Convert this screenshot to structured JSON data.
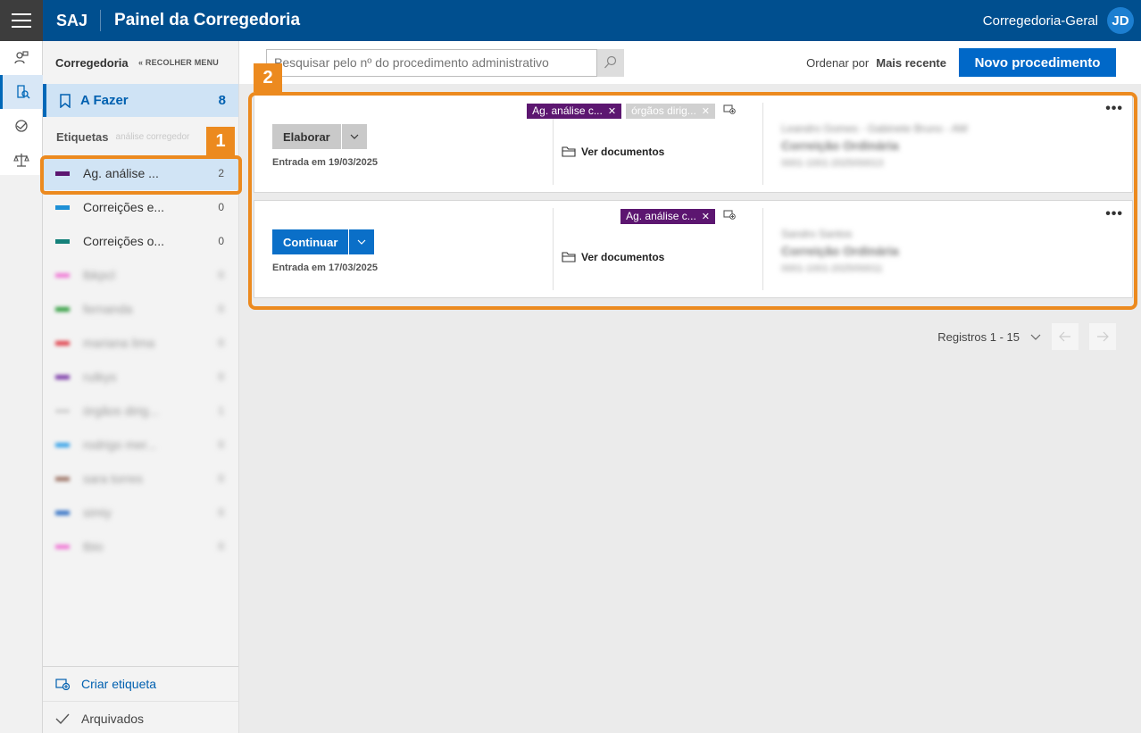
{
  "header": {
    "brand": "SAJ",
    "title": "Painel da Corregedoria",
    "user_name": "Corregedoria-Geral",
    "avatar_initials": "JD",
    "color": "#004f8f"
  },
  "rail": {
    "icons": [
      "user-task-icon",
      "document-search-icon",
      "handshake-icon",
      "scales-icon"
    ],
    "active_index": 1
  },
  "sidebar": {
    "title": "Corregedoria",
    "collapse_label": "RECOLHER MENU",
    "todo_label": "A Fazer",
    "todo_count": "8",
    "tags_title": "Etiquetas",
    "tags_hint": "análise corregedor",
    "tags": [
      {
        "label": "Ag. análise ...",
        "count": "2",
        "color": "#5c1670",
        "selected": true,
        "blurred": false
      },
      {
        "label": "Correições e...",
        "count": "0",
        "color": "#1e90d6",
        "selected": false,
        "blurred": false
      },
      {
        "label": "Correições o...",
        "count": "0",
        "color": "#14817a",
        "selected": false,
        "blurred": false
      },
      {
        "label": "lbkpcl",
        "count": "0",
        "color": "#f07ad6",
        "selected": false,
        "blurred": true
      },
      {
        "label": "fernanda",
        "count": "0",
        "color": "#2e9c3c",
        "selected": false,
        "blurred": true
      },
      {
        "label": "mariana lima",
        "count": "0",
        "color": "#e0404a",
        "selected": false,
        "blurred": true
      },
      {
        "label": "rutkys",
        "count": "0",
        "color": "#7b3aa8",
        "selected": false,
        "blurred": true
      },
      {
        "label": "órgãos dirig...",
        "count": "1",
        "color": "#d6d6d6",
        "selected": false,
        "blurred": true
      },
      {
        "label": "rodrigo mer...",
        "count": "0",
        "color": "#35a2e8",
        "selected": false,
        "blurred": true
      },
      {
        "label": "sara torres",
        "count": "0",
        "color": "#a0786a",
        "selected": false,
        "blurred": true
      },
      {
        "label": "simiy",
        "count": "0",
        "color": "#2f6fc4",
        "selected": false,
        "blurred": true
      },
      {
        "label": "tbio",
        "count": "0",
        "color": "#f07ad6",
        "selected": false,
        "blurred": true
      }
    ],
    "create_label": "Criar etiqueta",
    "archived_label": "Arquivados"
  },
  "toolbar": {
    "search_placeholder": "Pesquisar pelo nº do procedimento administrativo",
    "order_label": "Ordenar por",
    "order_value": "Mais recente",
    "new_button": "Novo procedimento"
  },
  "cards": [
    {
      "action": "Elaborar",
      "action_style": "grey",
      "entry": "Entrada em 19/03/2025",
      "chips": [
        {
          "label": "Ag. análise c...",
          "style": "purple"
        },
        {
          "label": "órgãos dirig...",
          "style": "grey"
        }
      ],
      "docs_label": "Ver documentos",
      "info_line1": "Leandro Gomes - Gabinete Bruno - AM",
      "info_line2": "Correição Ordinária",
      "info_line3": "0001-1001-2025/00013"
    },
    {
      "action": "Continuar",
      "action_style": "blue",
      "entry": "Entrada em 17/03/2025",
      "chips": [
        {
          "label": "Ag. análise c...",
          "style": "purple"
        }
      ],
      "docs_label": "Ver documentos",
      "info_line1": "Sandro Santos",
      "info_line2": "Correição Ordinária",
      "info_line3": "0001-1001-2025/00011"
    }
  ],
  "pager": {
    "label": "Registros 1 - 15"
  },
  "callouts": [
    "1",
    "2"
  ],
  "accent_color": "#ec8a1f"
}
